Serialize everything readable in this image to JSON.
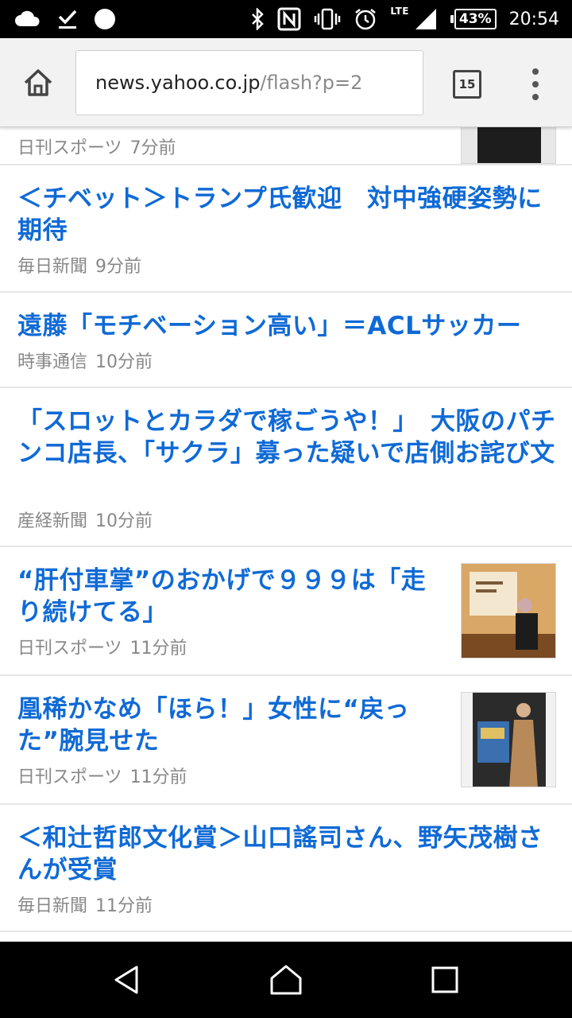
{
  "status_bar": {
    "lte": "LTE",
    "battery": "43%",
    "time": "20:54"
  },
  "browser": {
    "url_host": "news.yahoo.co.jp",
    "url_path": "/flash?p=2",
    "tab_count": "15"
  },
  "news": [
    {
      "title": "",
      "source": "日刊スポーツ",
      "time": "7分前"
    },
    {
      "title": "＜チベット＞トランプ氏歓迎　対中強硬姿勢に期待",
      "source": "毎日新聞",
      "time": "9分前"
    },
    {
      "title": "遠藤「モチベーション高い」＝ACLサッカー",
      "source": "時事通信",
      "time": "10分前"
    },
    {
      "title": "「スロットとカラダで稼ごうや！」　大阪のパチンコ店長、「サクラ」募った疑いで店側お詫び文",
      "source": "産経新聞",
      "time": "10分前"
    },
    {
      "title": "“肝付車掌”のおかげで９９９は「走り続けてる」",
      "source": "日刊スポーツ",
      "time": "11分前"
    },
    {
      "title": "凰稀かなめ「ほら！」女性に“戻った”腕見せた",
      "source": "日刊スポーツ",
      "time": "11分前"
    },
    {
      "title": "＜和辻哲郎文化賞＞山口謠司さん、野矢茂樹さんが受賞",
      "source": "毎日新聞",
      "time": "11分前"
    }
  ],
  "colors": {
    "link": "#0f6ad6",
    "meta": "#888888"
  }
}
